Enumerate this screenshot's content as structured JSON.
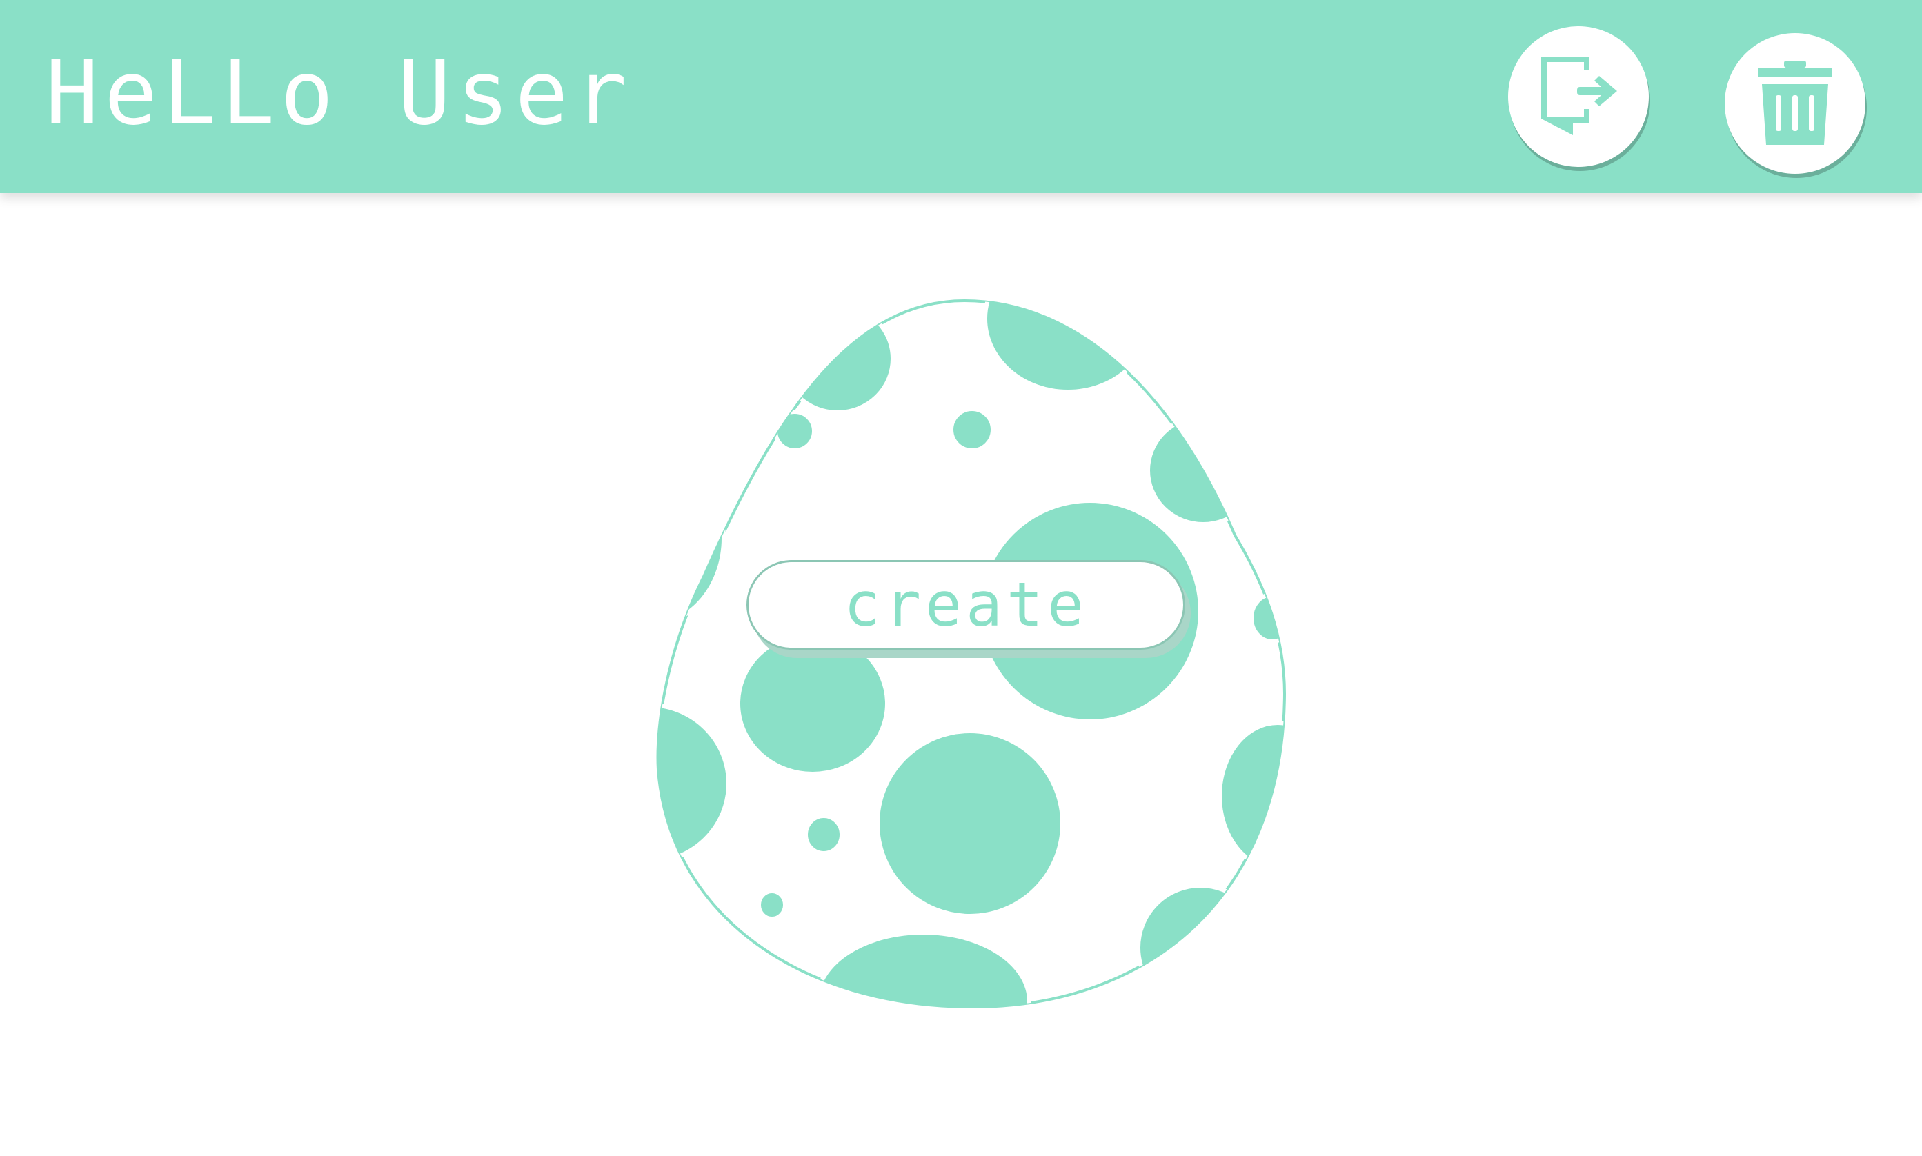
{
  "header": {
    "greeting": "HeLLo User",
    "background_color": "#8ae0c7"
  },
  "actions": {
    "logout_icon": "logout-icon",
    "delete_icon": "trash-icon"
  },
  "egg": {
    "spot_color": "#8ae0c7",
    "outline_color": "#8ae0c7"
  },
  "create_button": {
    "label": "create"
  }
}
